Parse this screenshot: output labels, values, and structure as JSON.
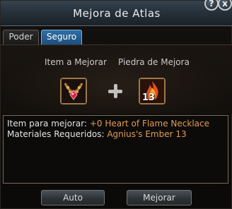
{
  "window": {
    "title": "Mejora de Atlas"
  },
  "titlebar_buttons": {
    "help": "?",
    "close": "x"
  },
  "tabs": [
    {
      "label": "Poder",
      "active": false
    },
    {
      "label": "Seguro",
      "active": true
    }
  ],
  "slots": {
    "item_label": "Item a Mejorar",
    "stone_label": "Piedra de Mejora",
    "stone_quantity": "13"
  },
  "info": {
    "item_label": "Item para mejorar:",
    "item_value": "+0 Heart of Flame Necklace",
    "materials_label": "Materiales Requeridos:",
    "materials_value": "Agnius's Ember 13"
  },
  "buttons": {
    "auto": "Auto",
    "upgrade": "Mejorar"
  },
  "colors": {
    "accent_tab": "#2e6fa6",
    "value_text": "#e39a52"
  }
}
